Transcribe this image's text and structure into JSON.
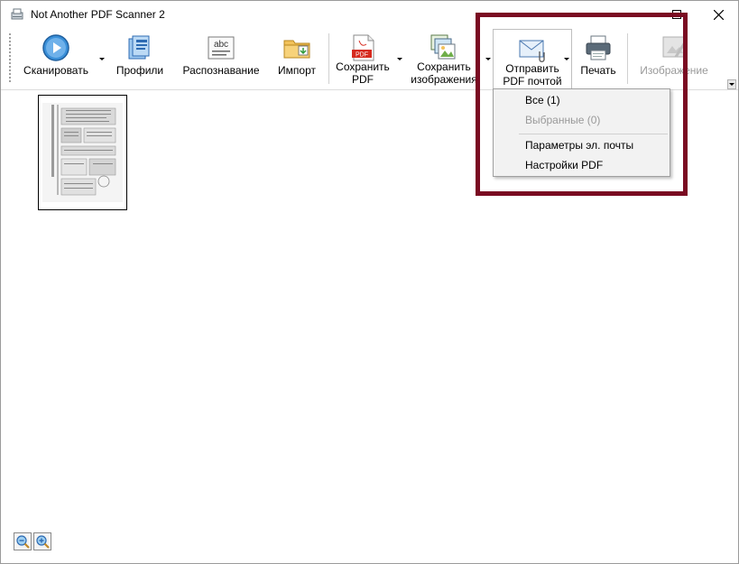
{
  "window": {
    "title": "Not Another PDF Scanner 2"
  },
  "toolbar": {
    "scan": "Сканировать",
    "profiles": "Профили",
    "ocr": "Распознавание",
    "import": "Импорт",
    "save_pdf": "Сохранить\nPDF",
    "save_images": "Сохранить\nизображения",
    "email_pdf": "Отправить\nPDF почтой",
    "print": "Печать",
    "image": "Изображение"
  },
  "email_menu": {
    "all": "Все (1)",
    "selected": "Выбранные (0)",
    "email_settings": "Параметры эл. почты",
    "pdf_settings": "Настройки PDF"
  },
  "colors": {
    "highlight": "#7a0b22",
    "scan_icon": "#3a8fd8",
    "pdf_icon": "#d62a1e",
    "folder_icon": "#f2c25a"
  }
}
